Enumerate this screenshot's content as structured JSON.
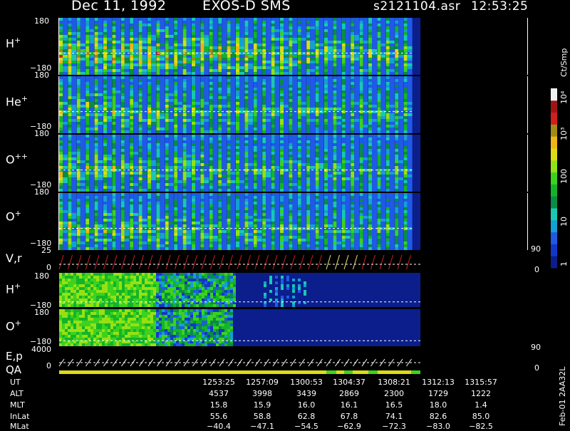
{
  "header": {
    "date": "Dec 11, 1992",
    "instrument": "EXOS-D SMS",
    "file": "s2121104.asr",
    "time": "12:53:25"
  },
  "panels": [
    {
      "label": "H",
      "charge": "+",
      "ymax": "180",
      "ymin": "−180"
    },
    {
      "label": "He",
      "charge": "+",
      "ymax": "180",
      "ymin": "−180"
    },
    {
      "label": "O",
      "charge": "++",
      "ymax": "180",
      "ymin": "−180"
    },
    {
      "label": "O",
      "charge": "+",
      "ymax": "180",
      "ymin": "−180"
    },
    {
      "label": "V,r",
      "charge": "",
      "ymax": "25",
      "ymin": "0",
      "right_top": "90",
      "right_bottom": "0"
    },
    {
      "label": "H",
      "charge": "+",
      "ymax": "180",
      "ymin": "−180"
    },
    {
      "label": "O",
      "charge": "+",
      "ymax": "180",
      "ymin": "−180"
    },
    {
      "label": "E,p",
      "label2": "QA",
      "charge": "",
      "ymax": "4000",
      "ymin": "0",
      "right_top": "90",
      "right_bottom": "0"
    }
  ],
  "colorbar": {
    "unit": "Ct/Smp",
    "ticks": [
      "1",
      "10",
      "100",
      "10³",
      "10⁴"
    ],
    "colors": [
      "#0b1e8c",
      "#1436c8",
      "#1f5ae6",
      "#14a0d2",
      "#18c8b4",
      "#0a8c46",
      "#14b428",
      "#3cd21e",
      "#96e114",
      "#dcdc14",
      "#f0b414",
      "#a08c14",
      "#d21e1e",
      "#a01414",
      "#f0f0f0"
    ]
  },
  "chart_data": {
    "type": "heatmap",
    "title": "Dec 11, 1992 EXOS-D SMS",
    "x_axis": "UT",
    "rows": [
      {
        "name": "UT",
        "values": [
          "1253:25",
          "1257:09",
          "1300:53",
          "1304:37",
          "1308:21",
          "1312:13",
          "1315:57"
        ]
      },
      {
        "name": "ALT",
        "values": [
          "4537",
          "3998",
          "3439",
          "2869",
          "2300",
          "1729",
          "1222"
        ]
      },
      {
        "name": "MLT",
        "values": [
          "15.8",
          "15.9",
          "16.0",
          "16.1",
          "16.5",
          "18.0",
          "1.4"
        ]
      },
      {
        "name": "InLat",
        "values": [
          "55.6",
          "58.8",
          "62.8",
          "67.8",
          "74.1",
          "82.6",
          "85.0"
        ]
      },
      {
        "name": "MLat",
        "values": [
          "−40.4",
          "−47.1",
          "−54.5",
          "−62.9",
          "−72.3",
          "−83.0",
          "−82.5"
        ]
      }
    ],
    "panels": [
      "H+",
      "He+",
      "O++",
      "O+",
      "V,r",
      "H+",
      "O+",
      "E,p QA"
    ],
    "colorbar_unit": "Ct/Smp",
    "colorbar_scale": "log",
    "colorbar_range": [
      1,
      10000
    ]
  },
  "side_label": "Feb-01 2AA32L"
}
